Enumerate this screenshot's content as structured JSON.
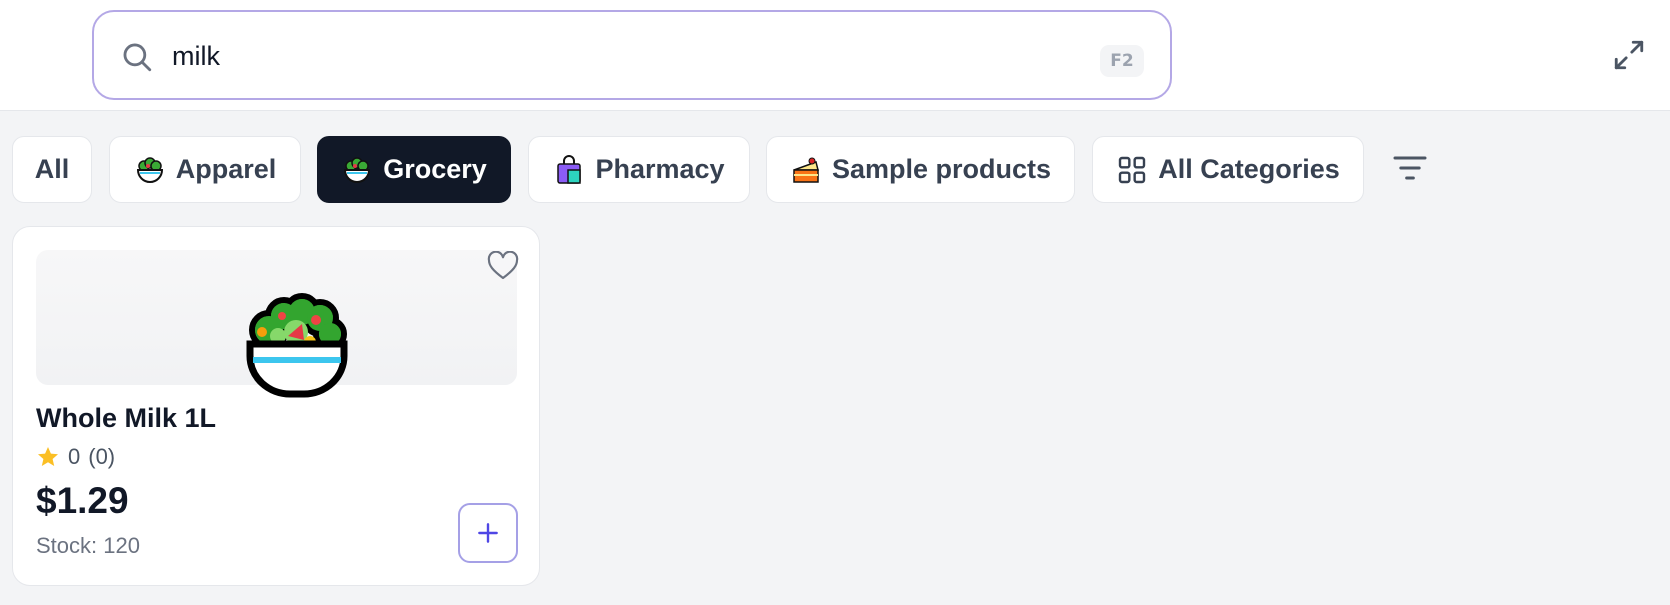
{
  "search": {
    "value": "milk",
    "shortcut": "F2"
  },
  "tabs": [
    {
      "label": "All",
      "icon": "",
      "active": false
    },
    {
      "label": "Apparel",
      "icon": "salad-icon",
      "active": false
    },
    {
      "label": "Grocery",
      "icon": "salad-icon",
      "active": true
    },
    {
      "label": "Pharmacy",
      "icon": "shopping-bag-icon",
      "active": false
    },
    {
      "label": "Sample products",
      "icon": "cake-icon",
      "active": false
    },
    {
      "label": "All Categories",
      "icon": "grid-icon",
      "active": false
    }
  ],
  "products": [
    {
      "name": "Whole Milk 1L",
      "rating": "0",
      "reviews": "(0)",
      "price": "$1.29",
      "stock": "Stock: 120",
      "icon": "salad-icon"
    }
  ],
  "colors": {
    "accent": "#b4a8e6",
    "active_tab": "#111827",
    "star": "#fbbf24",
    "add_button": "#4f46e5"
  }
}
